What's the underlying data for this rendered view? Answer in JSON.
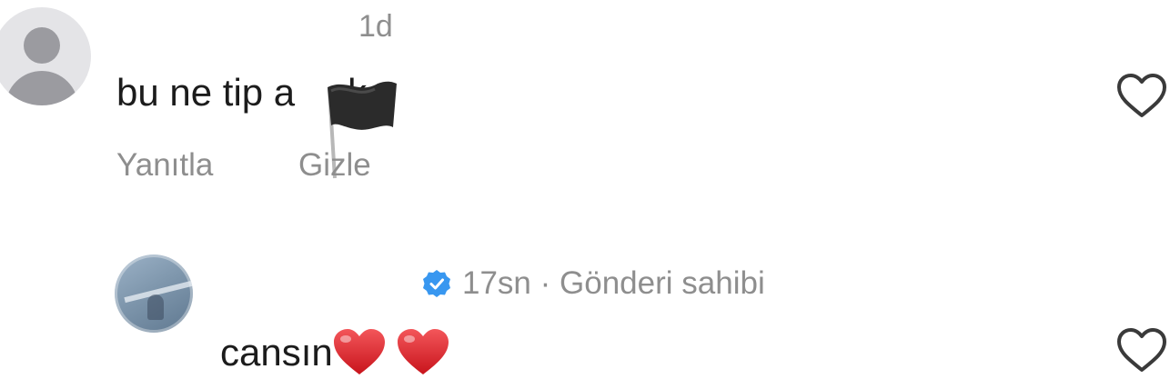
{
  "comment1": {
    "time": "1d",
    "text": "bu ne tip a",
    "text_tail": "k",
    "reply_label": "Yanıtla",
    "hide_label": "Gizle",
    "censor_icon": "black-flag-icon"
  },
  "comment2": {
    "time": "17sn",
    "separator": "·",
    "author_badge": "Gönderi sahibi",
    "text": "cansın",
    "emojis": [
      "red-heart-emoji",
      "red-heart-emoji"
    ],
    "verified_color": "#3897f0"
  },
  "colors": {
    "secondary_text": "#8e8e8e",
    "primary_text": "#1c1c1c",
    "heart_emoji": "#e0242c"
  }
}
